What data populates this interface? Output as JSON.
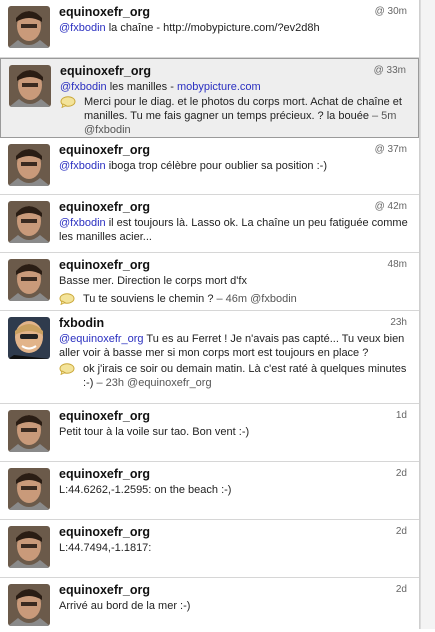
{
  "tweets": [
    {
      "user": "equinoxefr_org",
      "avatar": "equinoxefr-avatar",
      "time": "30m",
      "at": "@",
      "mention": "@fxbodin",
      "text": " la chaîne - http://mobypicture.com/?ev2d8h"
    },
    {
      "user": "equinoxefr_org",
      "avatar": "equinoxefr-avatar",
      "time": "33m",
      "at": "@",
      "mention": "@fxbodin",
      "text": " les manilles - ",
      "link": "mobypicture.com",
      "reply_text": "Merci pour le diag. et le photos du corps mort. Achat de chaîne et manilles. Tu me fais gagner un temps précieux. ? la bouée",
      "reply_meta": " – 5m @fxbodin"
    },
    {
      "user": "equinoxefr_org",
      "avatar": "equinoxefr-avatar",
      "time": "37m",
      "at": "@",
      "mention": "@fxbodin",
      "text": " iboga trop célèbre pour oublier sa position :-)"
    },
    {
      "user": "equinoxefr_org",
      "avatar": "equinoxefr-avatar",
      "time": "42m",
      "at": "@",
      "mention": "@fxbodin",
      "text": " il est toujours là. Lasso ok. La chaîne un peu fatiguée comme les manilles acier..."
    },
    {
      "user": "equinoxefr_org",
      "avatar": "equinoxefr-avatar",
      "time": "48m",
      "at": "",
      "mention": "",
      "text": "Basse mer. Direction le corps mort d'fx",
      "reply_text": "Tu te souviens le chemin ?",
      "reply_meta": " – 46m @fxbodin"
    },
    {
      "user": "fxbodin",
      "avatar": "fxbodin-avatar",
      "time": "23h",
      "at": "",
      "mention": "@equinoxefr_org",
      "text": " Tu es au Ferret ! Je n'avais pas capté... Tu veux bien aller voir à basse mer si mon corps mort est toujours en place ?",
      "reply_text": "ok j'irais ce soir ou demain matin. Là c'est raté à quelques minutes :-)",
      "reply_meta": " – 23h @equinoxefr_org"
    },
    {
      "user": "equinoxefr_org",
      "avatar": "equinoxefr-avatar",
      "time": "1d",
      "at": "",
      "mention": "",
      "text": "Petit tour à la voile sur tao. Bon vent :-)"
    },
    {
      "user": "equinoxefr_org",
      "avatar": "equinoxefr-avatar",
      "time": "2d",
      "at": "",
      "mention": "",
      "text": "L:44.6262,-1.2595: on the beach :-)"
    },
    {
      "user": "equinoxefr_org",
      "avatar": "equinoxefr-avatar",
      "time": "2d",
      "at": "",
      "mention": "",
      "text": "L:44.7494,-1.1817:"
    },
    {
      "user": "equinoxefr_org",
      "avatar": "equinoxefr-avatar",
      "time": "2d",
      "at": "",
      "mention": "",
      "text": "Arrivé au bord de la mer :-)"
    }
  ]
}
